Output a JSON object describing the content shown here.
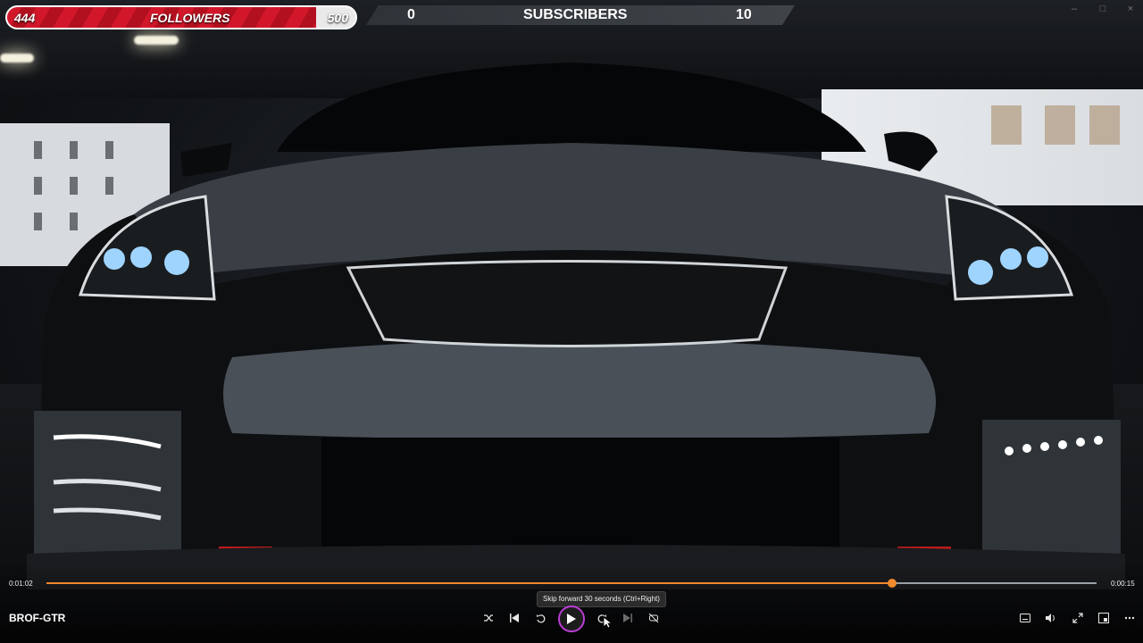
{
  "overlay": {
    "followers": {
      "current": "444",
      "label": "FOLLOWERS",
      "goal": "500",
      "progress": 0.888
    },
    "subscribers": {
      "current": "0",
      "label": "SUBSCRIBERS",
      "goal": "10"
    }
  },
  "player": {
    "current_time": "0:01:02",
    "remaining_time": "0:00:15",
    "progress": 0.805,
    "title": "BROF-GTR",
    "tooltip": "Skip forward 30 seconds (Ctrl+Right)",
    "accent_color": "#f08a2c"
  },
  "icons": {
    "shuffle": "shuffle-icon",
    "previous": "previous-icon",
    "rewind": "skip-back-10-icon",
    "play": "play-icon",
    "forward": "skip-forward-30-icon",
    "next": "next-icon",
    "repeat": "repeat-off-icon",
    "captions": "captions-icon",
    "volume": "volume-icon",
    "fullscreen": "fullscreen-icon",
    "miniplayer": "miniplayer-icon",
    "more": "more-icon"
  }
}
